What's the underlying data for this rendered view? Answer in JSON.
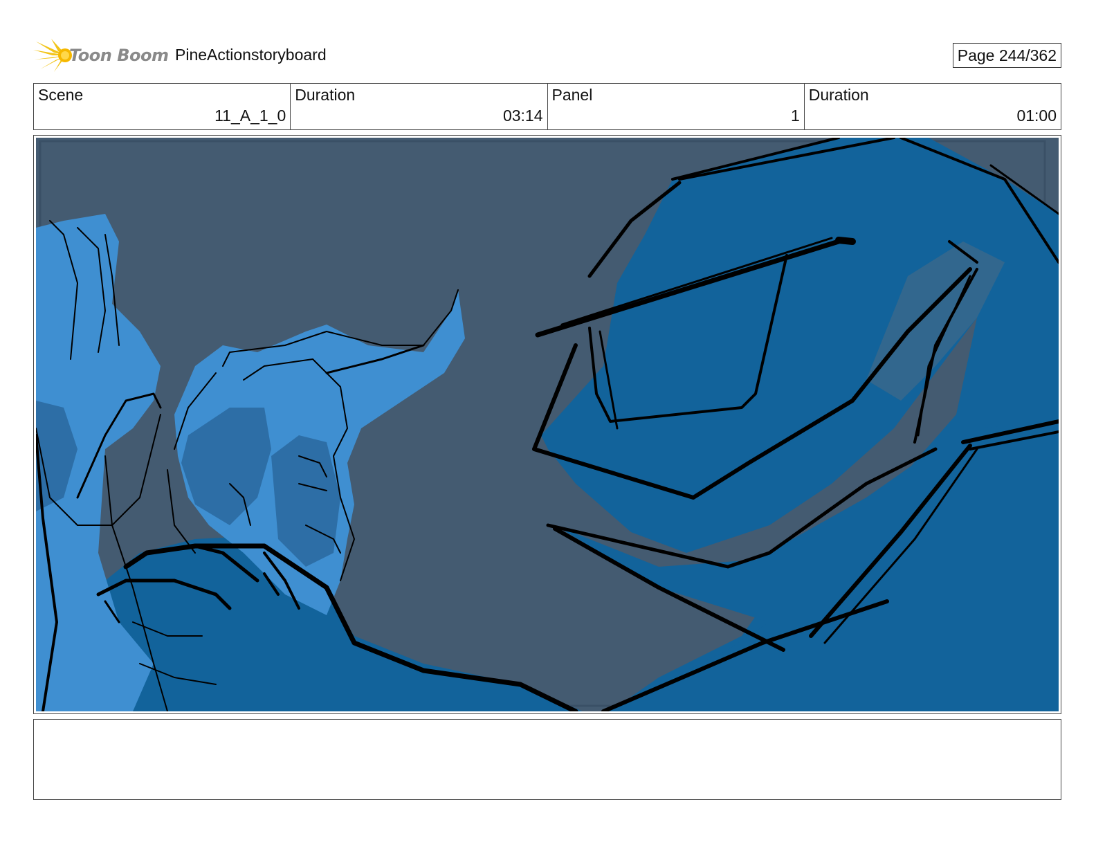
{
  "header": {
    "logo_text": "Toon Boom",
    "project_title": "PineActionstoryboard",
    "page_label": "Page 244/362"
  },
  "info": {
    "scene_label": "Scene",
    "scene_value": "11_A_1_0",
    "scene_duration_label": "Duration",
    "scene_duration_value": "03:14",
    "panel_label": "Panel",
    "panel_value": "1",
    "panel_duration_label": "Duration",
    "panel_duration_value": "01:00"
  },
  "notes": {
    "text": ""
  },
  "colors": {
    "background_slate": "#445b71",
    "creature_blue": "#12639b",
    "hero_light_blue": "#3f8fd1",
    "hero_shadow_blue": "#2d6ea6",
    "ink": "#000000",
    "logo_yellow": "#f2c417"
  }
}
